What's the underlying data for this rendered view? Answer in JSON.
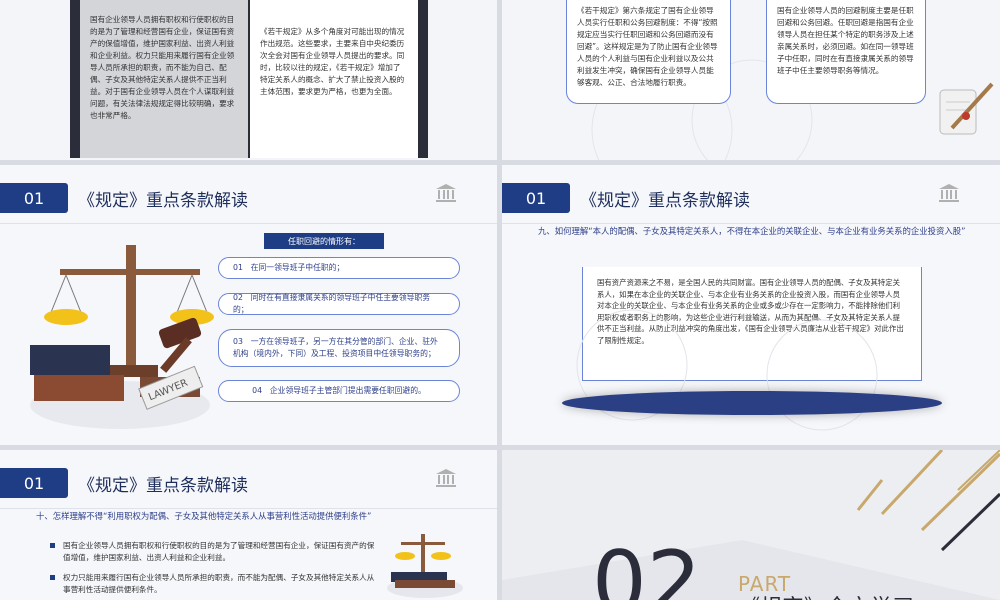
{
  "slide1": {
    "left_text": "国有企业领导人员拥有职权和行使职权的目的是为了管理和经营国有企业，保证国有资产的保值增值，维护国家利益、出资人利益和企业利益。权力只能用来履行国有企业领导人员所承担的职责，而不能为自己、配偶、子女及其他特定关系人提供不正当利益。对于国有企业领导人员在个人谋取利益问题，有关法律法规规定得比较明确，要求也非常严格。",
    "right_text": "《若干规定》从多个角度对可能出现的情况作出规范。这些要求，主要来自中央纪委历次全会对国有企业领导人员提出的要求。同时，比较以往的规定，《若干规定》增加了特定关系人的概念、扩大了禁止投资入股的主体范围，要求更为严格，也更为全面。"
  },
  "slide2": {
    "box1": "《若干规定》第六条规定了国有企业领导人员实行任职和公务回避制度：不得“按照规定应当实行任职回避和公务回避而没有回避”。这样规定是为了防止国有企业领导人员的个人利益与国有企业利益以及公共利益发生冲突，确保国有企业领导人员能够客观、公正、合法地履行职责。",
    "box2": "国有企业领导人员的回避制度主要是任职回避和公务回避。任职回避是指国有企业领导人员在担任某个特定的职务涉及上述亲属关系时，必须回避。如在同一领导班子中任职，同时在有直接隶属关系的领导班子中任主要领导职务等情况。"
  },
  "header": {
    "num": "01",
    "title": "《规定》重点条款解读"
  },
  "slide3": {
    "heading": "任职回避的情形有：",
    "items": [
      "01　在同一领导班子中任职的；",
      "02　同时在有直接隶属关系的领导班子中任主要领导职务的；",
      "03　一方在领导班子，另一方在其分管的部门、企业、驻外机构（境内外，下同）及工程、投资项目中任领导职务的；",
      "04　企业领导班子主管部门提出需要任职回避的。"
    ],
    "lawyer_label": "LAWYER"
  },
  "slide4": {
    "question": "九、如何理解“本人的配偶、子女及其特定关系人，不得在本企业的关联企业、与本企业有业务关系的企业投资入股”",
    "body": "国有资产资源来之不易，是全国人民的共同财富。国有企业领导人员的配偶、子女及其特定关系人，如果在本企业的关联企业、与本企业有业务关系的企业投资入股，而国有企业领导人员对本企业的关联企业、与本企业有业务关系的企业或多或少存在一定影响力，不能排除他们利用职权或者职务上的影响，为这些企业进行利益输送，从而为其配偶、子女及其特定关系人提供不正当利益。从防止利益冲突的角度出发，《国有企业领导人员廉洁从业若干规定》对此作出了限制性规定。"
  },
  "slide5": {
    "question": "十、怎样理解不得“利用职权为配偶、子女及其他特定关系人从事营利性活动提供便利条件”",
    "bullets": [
      "国有企业领导人员拥有职权和行使职权的目的是为了管理和经营国有企业，保证国有资产的保值增值，维护国家利益、出资人利益和企业利益。",
      "权力只能用来履行国有企业领导人员所承担的职责，而不能为配偶、子女及其他特定关系人从事营利性活动提供便利条件。"
    ]
  },
  "slide6": {
    "big_num": "02",
    "part": "PART",
    "subtitle": "《规定》全文学习"
  },
  "colors": {
    "navy": "#1f3d84",
    "gold": "#c8a86b",
    "accent_blue": "#6a84d8"
  }
}
